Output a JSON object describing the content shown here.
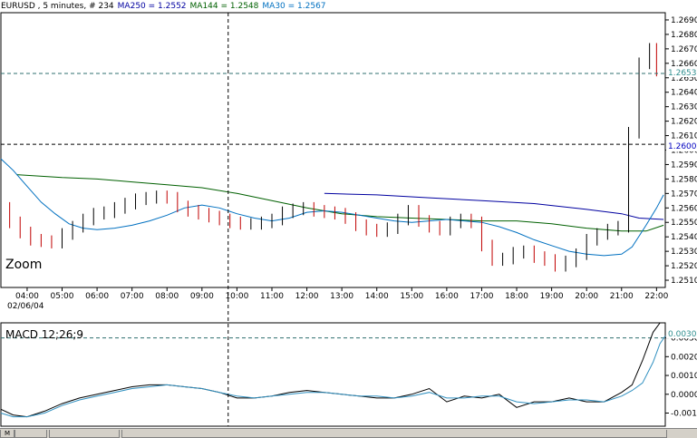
{
  "title_bar": {
    "symbol_text": "EURUSD , 5 minutes, # 234",
    "ma250_text": "MA250 = 1.2552",
    "ma144_text": "MA144 = 1.2548",
    "ma30_text": "MA30 = 1.2567",
    "colors": {
      "symbol": "#000000",
      "ma250": "#0000a0",
      "ma144": "#006000",
      "ma30": "#0070c0"
    }
  },
  "price_panel": {
    "zoom_label": "Zoom",
    "date_label": "02/06/04",
    "price_tag_upper": "1.2653",
    "price_tag_lower": "1.2600"
  },
  "macd_panel": {
    "label": "MACD 12;26;9",
    "top_tag": "0.0030"
  },
  "chart_data": [
    {
      "type": "line",
      "title": "EURUSD , 5 minutes, # 234",
      "x_tick_labels": [
        "04:00",
        "05:00",
        "06:00",
        "07:00",
        "08:00",
        "09:00",
        "10:00",
        "11:00",
        "12:00",
        "13:00",
        "14:00",
        "15:00",
        "16:00",
        "17:00",
        "18:00",
        "19:00",
        "20:00",
        "21:00",
        "22:00"
      ],
      "y_tick_labels": [
        "1.2510",
        "1.2520",
        "1.2530",
        "1.2540",
        "1.2550",
        "1.2560",
        "1.2570",
        "1.2580",
        "1.2590",
        "1.2600",
        "1.2610",
        "1.2620",
        "1.2630",
        "1.2640",
        "1.2650",
        "1.2660",
        "1.2670",
        "1.2680",
        "1.2690"
      ],
      "ylim": [
        1.2505,
        1.2695
      ],
      "xlim": [
        3.25,
        22.25
      ],
      "crosshair": {
        "x": 9.75,
        "y": 1.2604
      },
      "hline_dashed": 1.2653,
      "price_bars": {
        "color_up": "#000000",
        "color_down": "#c00000",
        "x": [
          3.2,
          3.5,
          3.8,
          4.1,
          4.4,
          4.7,
          5.0,
          5.3,
          5.6,
          5.9,
          6.2,
          6.5,
          6.8,
          7.1,
          7.4,
          7.7,
          8.0,
          8.3,
          8.6,
          8.9,
          9.2,
          9.5,
          9.8,
          10.1,
          10.4,
          10.7,
          11.0,
          11.3,
          11.6,
          11.9,
          12.2,
          12.5,
          12.8,
          13.1,
          13.4,
          13.7,
          14.0,
          14.3,
          14.6,
          14.9,
          15.2,
          15.5,
          15.8,
          16.1,
          16.4,
          16.7,
          17.0,
          17.3,
          17.6,
          17.9,
          18.2,
          18.5,
          18.8,
          19.1,
          19.4,
          19.7,
          20.0,
          20.3,
          20.6,
          20.9,
          21.2,
          21.5,
          21.8,
          22.0
        ],
        "close": [
          1.256,
          1.255,
          1.2543,
          1.2538,
          1.2537,
          1.2536,
          1.2542,
          1.2547,
          1.2552,
          1.2556,
          1.2557,
          1.256,
          1.2563,
          1.2566,
          1.2567,
          1.2568,
          1.2567,
          1.2561,
          1.2558,
          1.2556,
          1.2554,
          1.2552,
          1.255,
          1.2549,
          1.2549,
          1.255,
          1.2552,
          1.2557,
          1.2559,
          1.256,
          1.2558,
          1.2557,
          1.2556,
          1.2553,
          1.2548,
          1.2545,
          1.2544,
          1.2546,
          1.2552,
          1.2558,
          1.2551,
          1.2547,
          1.2545,
          1.255,
          1.2552,
          1.255,
          1.2534,
          1.2524,
          1.2525,
          1.2529,
          1.253,
          1.2526,
          1.2524,
          1.252,
          1.2523,
          1.2528,
          1.2538,
          1.2542,
          1.2545,
          1.2547,
          1.2612,
          1.266,
          1.267,
          1.2655
        ]
      },
      "series": [
        {
          "name": "MA250",
          "color": "#0000a0",
          "x": [
            12.5,
            14,
            15.5,
            17,
            18.5,
            20,
            21,
            21.5,
            22.2
          ],
          "y": [
            1.257,
            1.2569,
            1.2567,
            1.2565,
            1.2563,
            1.2559,
            1.2556,
            1.2553,
            1.2552
          ]
        },
        {
          "name": "MA144",
          "color": "#006000",
          "x": [
            3.7,
            5,
            6,
            7,
            8,
            9,
            10,
            11,
            12,
            13,
            14,
            15,
            16,
            17,
            18,
            19,
            20,
            21,
            21.7,
            22.2
          ],
          "y": [
            1.2583,
            1.2581,
            1.258,
            1.2578,
            1.2576,
            1.2574,
            1.257,
            1.2565,
            1.256,
            1.2556,
            1.2554,
            1.2553,
            1.2552,
            1.2551,
            1.2551,
            1.2549,
            1.2546,
            1.2544,
            1.2544,
            1.2548
          ]
        },
        {
          "name": "MA30",
          "color": "#0070c0",
          "x": [
            3.25,
            3.6,
            4,
            4.4,
            4.8,
            5.2,
            5.6,
            6,
            6.5,
            7,
            7.5,
            8,
            8.5,
            9,
            9.5,
            10,
            10.5,
            11,
            11.5,
            12,
            12.5,
            13,
            13.5,
            14,
            14.5,
            15,
            15.5,
            16,
            16.5,
            17,
            17.5,
            18,
            18.5,
            19,
            19.5,
            20,
            20.5,
            21,
            21.3,
            21.7,
            22,
            22.2
          ],
          "y": [
            1.2594,
            1.2586,
            1.2575,
            1.2564,
            1.2556,
            1.2549,
            1.2546,
            1.2545,
            1.2546,
            1.2548,
            1.2551,
            1.2555,
            1.256,
            1.2562,
            1.256,
            1.2556,
            1.2553,
            1.2551,
            1.2553,
            1.2557,
            1.2558,
            1.2557,
            1.2555,
            1.2553,
            1.2551,
            1.255,
            1.2551,
            1.2552,
            1.2551,
            1.255,
            1.2547,
            1.2543,
            1.2538,
            1.2534,
            1.253,
            1.2528,
            1.2527,
            1.2528,
            1.2533,
            1.2548,
            1.256,
            1.2569
          ]
        }
      ]
    },
    {
      "type": "line",
      "title": "MACD 12;26;9",
      "y_tick_labels": [
        "-0.0010",
        "0.0000",
        "0.0010",
        "0.0020",
        "0.0030"
      ],
      "ylim": [
        -0.0017,
        0.0038
      ],
      "xlim": [
        3.25,
        22.25
      ],
      "hline_dashed": 0.003,
      "series": [
        {
          "name": "MACD",
          "color": "#000000",
          "x": [
            3.25,
            3.6,
            4,
            4.5,
            5,
            5.5,
            6,
            6.5,
            7,
            7.5,
            8,
            8.5,
            9,
            9.5,
            10,
            10.5,
            11,
            11.5,
            12,
            12.5,
            13,
            13.5,
            14,
            14.5,
            15,
            15.5,
            16,
            16.5,
            17,
            17.5,
            18,
            18.5,
            19,
            19.5,
            20,
            20.5,
            21,
            21.3,
            21.6,
            21.9,
            22.1,
            22.25
          ],
          "y": [
            -0.0008,
            -0.0011,
            -0.0012,
            -0.0009,
            -0.0005,
            -0.0002,
            0.0,
            0.0002,
            0.0004,
            0.0005,
            0.0005,
            0.0004,
            0.0003,
            0.0001,
            -0.0002,
            -0.0002,
            -0.0001,
            0.0001,
            0.0002,
            0.0001,
            0.0,
            -0.0001,
            -0.0002,
            -0.0002,
            0.0,
            0.0003,
            -0.0004,
            -0.0001,
            -0.0002,
            0.0,
            -0.0007,
            -0.0004,
            -0.0004,
            -0.0002,
            -0.0004,
            -0.0004,
            0.0001,
            0.0005,
            0.0018,
            0.0033,
            0.0038,
            0.0038
          ]
        },
        {
          "name": "Signal",
          "color": "#3090c0",
          "x": [
            3.25,
            3.6,
            4,
            4.5,
            5,
            5.5,
            6,
            6.5,
            7,
            7.5,
            8,
            8.5,
            9,
            9.5,
            10,
            10.5,
            11,
            11.5,
            12,
            12.5,
            13,
            13.5,
            14,
            14.5,
            15,
            15.5,
            16,
            16.5,
            17,
            17.5,
            18,
            18.5,
            19,
            19.5,
            20,
            20.5,
            21,
            21.3,
            21.6,
            21.9,
            22.1,
            22.25
          ],
          "y": [
            -0.001,
            -0.0012,
            -0.0012,
            -0.001,
            -0.0006,
            -0.0003,
            -0.0001,
            0.0001,
            0.0003,
            0.0004,
            0.0005,
            0.0004,
            0.0003,
            0.0001,
            -0.0001,
            -0.0002,
            -0.0001,
            0.0,
            0.0001,
            0.0001,
            0.0,
            -0.0001,
            -0.0001,
            -0.0002,
            -0.0001,
            0.0001,
            -0.0002,
            -0.0002,
            -0.0001,
            -0.0001,
            -0.0004,
            -0.0005,
            -0.0004,
            -0.0003,
            -0.0003,
            -0.0004,
            -0.0001,
            0.0002,
            0.0006,
            0.0017,
            0.0027,
            0.0031
          ]
        }
      ]
    }
  ],
  "bottom_bar": {
    "tab_labels": [
      "M",
      "",
      "",
      ""
    ]
  }
}
